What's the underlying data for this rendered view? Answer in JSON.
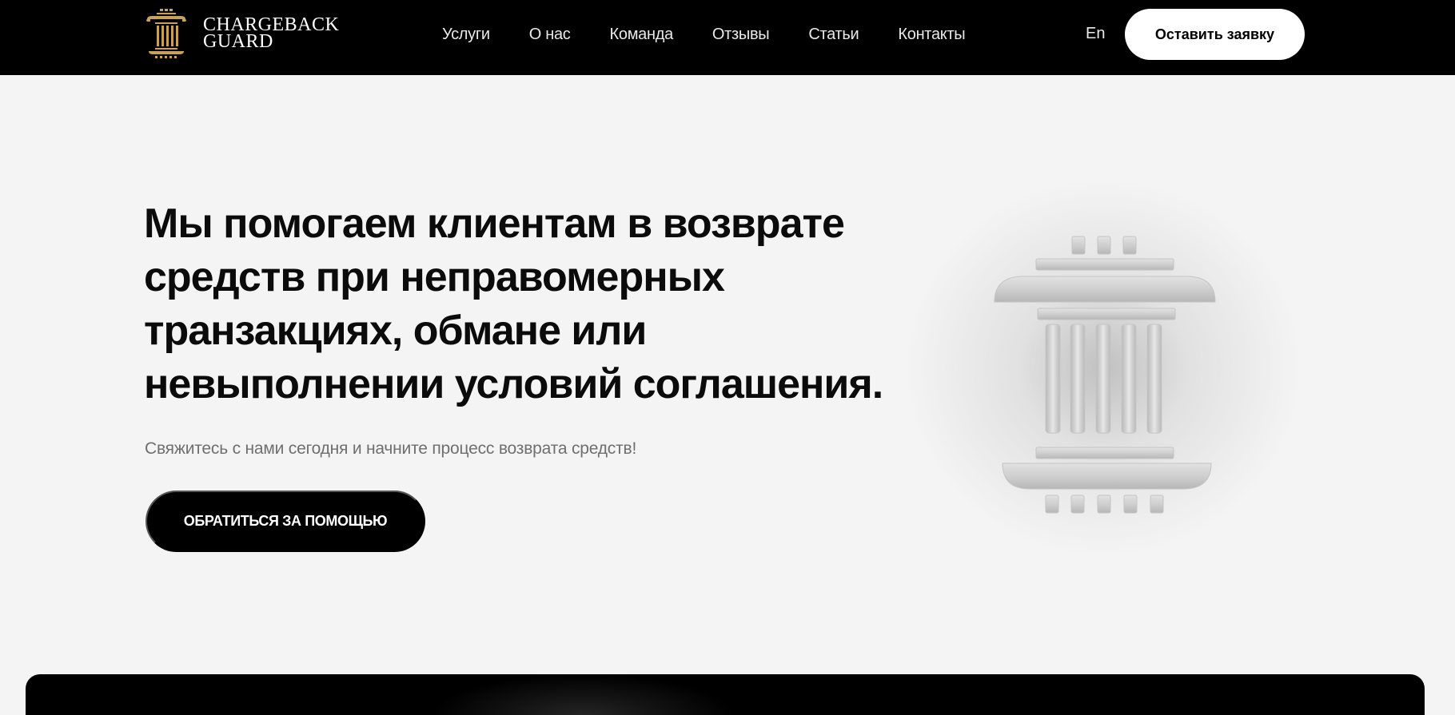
{
  "header": {
    "logo": {
      "line1": "CHARGEBACK",
      "line2": "GUARD",
      "icon": "pillar-logo-icon",
      "accent_color": "#c9a25a"
    },
    "nav": [
      {
        "label": "Услуги"
      },
      {
        "label": "О нас"
      },
      {
        "label": "Команда"
      },
      {
        "label": "Отзывы"
      },
      {
        "label": "Статьи"
      },
      {
        "label": "Контакты"
      }
    ],
    "lang_label": "En",
    "cta_label": "Оставить заявку"
  },
  "hero": {
    "title": "Мы помогаем клиентам в возврате средств при неправомерных транзакциях, обмане или невыполнении условий соглашения.",
    "subtitle": "Свяжитесь с нами сегодня и начните процесс возврата средств!",
    "button_label": "ОБРАТИТЬСЯ ЗА ПОМОЩЬЮ",
    "illustration_icon": "pillar-icon"
  },
  "colors": {
    "header_bg": "#000000",
    "page_bg": "#f4f4f4",
    "accent_gold": "#c9a25a"
  }
}
